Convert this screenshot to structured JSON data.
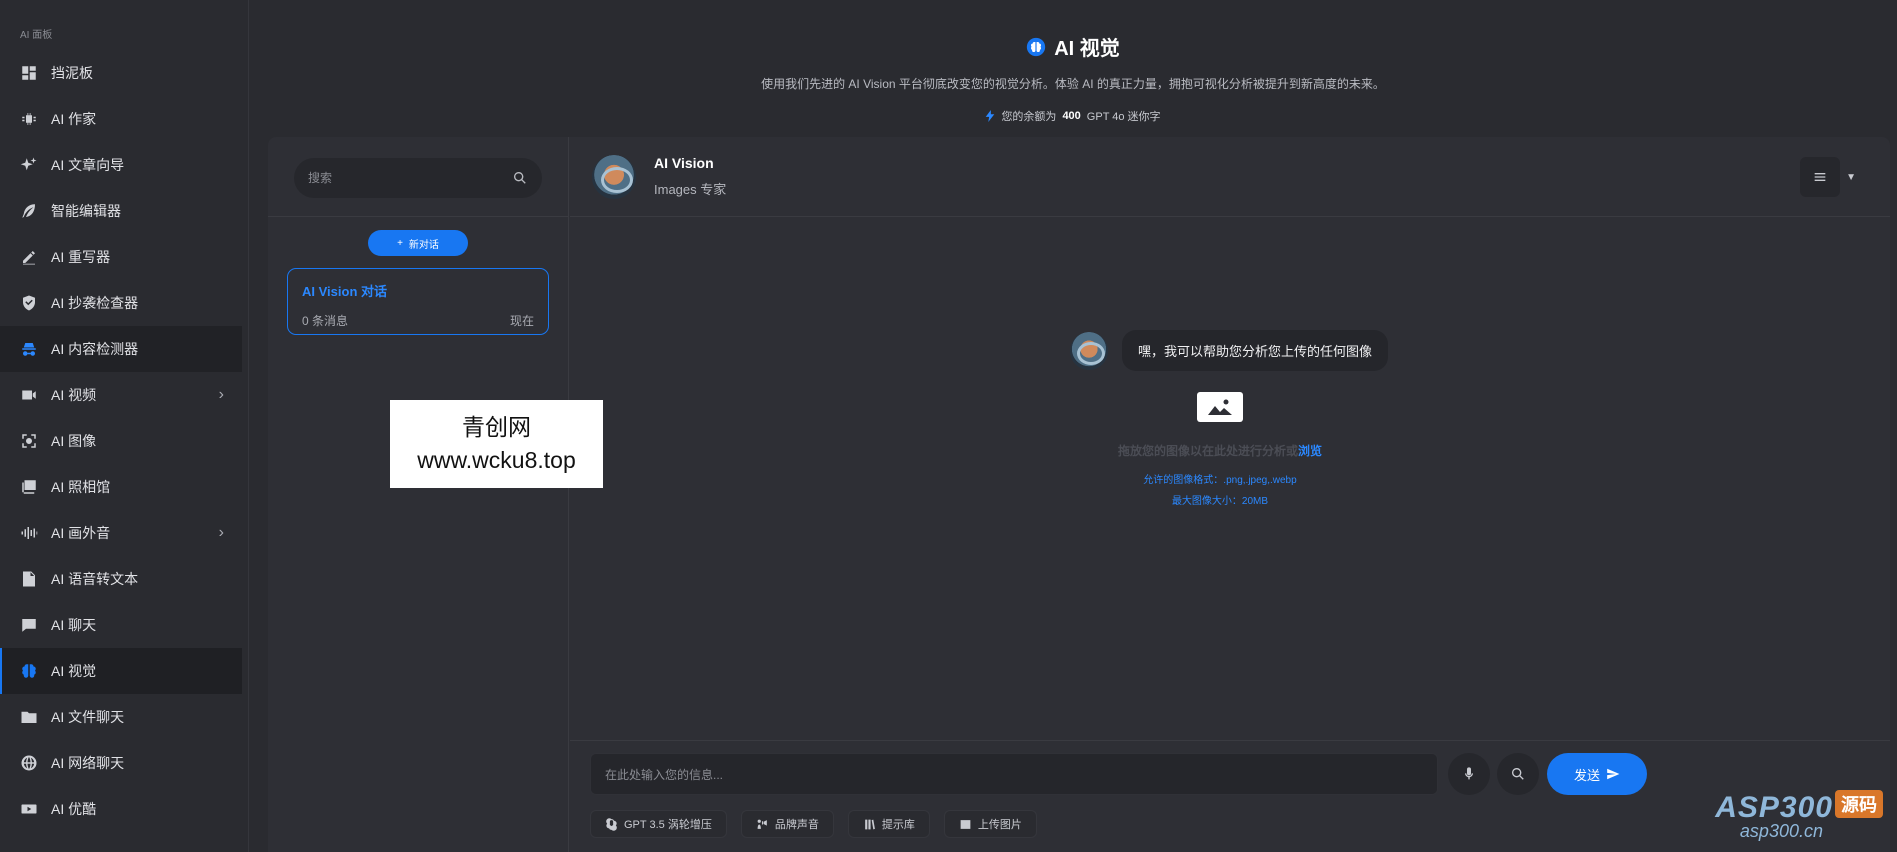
{
  "sidebar": {
    "caption": "AI 面板",
    "items": [
      {
        "label": "挡泥板",
        "icon": "dashboard-icon"
      },
      {
        "label": "AI 作家",
        "icon": "chip-icon"
      },
      {
        "label": "AI 文章向导",
        "icon": "sparkles-icon"
      },
      {
        "label": "智能编辑器",
        "icon": "feather-icon"
      },
      {
        "label": "AI 重写器",
        "icon": "pen-icon"
      },
      {
        "label": "AI 抄袭检查器",
        "icon": "shield-check-icon"
      },
      {
        "label": "AI 内容检测器",
        "icon": "detective-icon"
      },
      {
        "label": "AI 视频",
        "icon": "video-icon"
      },
      {
        "label": "AI 图像",
        "icon": "image-scan-icon"
      },
      {
        "label": "AI 照相馆",
        "icon": "photo-gallery-icon"
      },
      {
        "label": "AI 画外音",
        "icon": "waveform-icon"
      },
      {
        "label": "AI 语音转文本",
        "icon": "audio-file-icon"
      },
      {
        "label": "AI 聊天",
        "icon": "chat-icon"
      },
      {
        "label": "AI 视觉",
        "icon": "brain-icon"
      },
      {
        "label": "AI 文件聊天",
        "icon": "folder-chat-icon"
      },
      {
        "label": "AI 网络聊天",
        "icon": "globe-icon"
      },
      {
        "label": "AI 优酷",
        "icon": "youtube-icon"
      }
    ]
  },
  "header": {
    "title": "AI 视觉",
    "subtitle": "使用我们先进的 AI Vision 平台彻底改变您的视觉分析。体验 AI 的真正力量，拥抱可视化分析被提升到新高度的未来。",
    "balance_prefix": "您的余额为",
    "balance_amount": "400",
    "balance_suffix": "GPT 4o 迷你字"
  },
  "conversations": {
    "search_placeholder": "搜索",
    "new_chat_label": "新对话",
    "items": [
      {
        "title": "AI Vision 对话",
        "count": "0 条消息",
        "time": "现在"
      }
    ]
  },
  "watermark": {
    "line1": "青创网",
    "line2": "www.wcku8.top"
  },
  "chat": {
    "bot_name": "AI Vision",
    "bot_role": "Images 专家",
    "greeting": "嘿，我可以帮助您分析您上传的任何图像",
    "upload_hint": "拖放您的图像以在此处进行分析或",
    "upload_browse": "浏览",
    "allowed_formats": "允许的图像格式：.png,.jpeg,.webp",
    "max_size": "最大图像大小：20MB"
  },
  "composer": {
    "placeholder": "在此处输入您的信息...",
    "send_label": "发送",
    "tools": [
      {
        "label": "GPT 3.5 涡轮增压",
        "icon": "openai-icon"
      },
      {
        "label": "品牌声音",
        "icon": "brand-voice-icon"
      },
      {
        "label": "提示库",
        "icon": "prompt-library-icon"
      },
      {
        "label": "上传图片",
        "icon": "image-upload-icon"
      }
    ]
  },
  "corner_mark": {
    "brand": "ASP300",
    "tag": "源码",
    "domain": "asp300.cn"
  },
  "colors": {
    "accent": "#1877f2",
    "background": "#2a2b30",
    "panel": "#2e2f35"
  }
}
